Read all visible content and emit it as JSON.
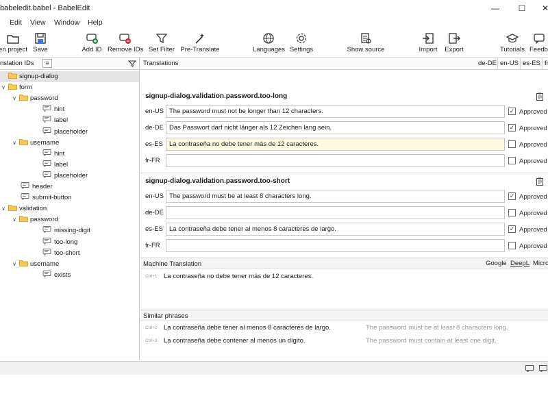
{
  "window": {
    "title": "babeledit.babel - BabelEdit",
    "minimize": "—",
    "maximize": "☐",
    "close": "✕"
  },
  "menu": [
    "Edit",
    "View",
    "Window",
    "Help"
  ],
  "toolbar": [
    {
      "label": "en project",
      "icon": "open-folder-icon"
    },
    {
      "label": "Save",
      "icon": "save-icon"
    },
    {
      "label": "Add ID",
      "icon": "add-id-icon"
    },
    {
      "label": "Remove IDs",
      "icon": "remove-ids-icon"
    },
    {
      "label": "Set Filter",
      "icon": "filter-icon"
    },
    {
      "label": "Pre-Translate",
      "icon": "magic-wand-icon"
    },
    {
      "label": "Languages",
      "icon": "globe-icon"
    },
    {
      "label": "Settings",
      "icon": "gear-icon"
    },
    {
      "label": "Show source",
      "icon": "show-source-icon"
    },
    {
      "label": "Import",
      "icon": "import-icon"
    },
    {
      "label": "Export",
      "icon": "export-icon"
    },
    {
      "label": "Tutorials",
      "icon": "graduation-cap-icon"
    },
    {
      "label": "Feedb",
      "icon": "feedback-icon"
    }
  ],
  "left_panel": {
    "header": "nslation IDs",
    "tree": [
      {
        "label": "signup-dialog",
        "type": "folder",
        "level": 0,
        "chevron": "",
        "selected": true
      },
      {
        "label": "form",
        "type": "folder",
        "level": 0,
        "chevron": "∨"
      },
      {
        "label": "password",
        "type": "folder",
        "level": 1,
        "chevron": "∨"
      },
      {
        "label": "hint",
        "type": "item",
        "level": 2
      },
      {
        "label": "label",
        "type": "item",
        "level": 2
      },
      {
        "label": "placeholder",
        "type": "item",
        "level": 2
      },
      {
        "label": "username",
        "type": "folder",
        "level": 1,
        "chevron": "∨"
      },
      {
        "label": "hint",
        "type": "item",
        "level": 2
      },
      {
        "label": "label",
        "type": "item",
        "level": 2
      },
      {
        "label": "placeholder",
        "type": "item",
        "level": 2
      },
      {
        "label": "header",
        "type": "item",
        "level": 0
      },
      {
        "label": "submit-button",
        "type": "item",
        "level": 0
      },
      {
        "label": "validation",
        "type": "folder",
        "level": 0,
        "chevron": "∨"
      },
      {
        "label": "password",
        "type": "folder",
        "level": 1,
        "chevron": "∨"
      },
      {
        "label": "missing-digit",
        "type": "item",
        "level": 2
      },
      {
        "label": "too-long",
        "type": "item",
        "level": 2
      },
      {
        "label": "too-short",
        "type": "item",
        "level": 2
      },
      {
        "label": "username",
        "type": "folder",
        "level": 1,
        "chevron": "∨"
      },
      {
        "label": "exists",
        "type": "item",
        "level": 2
      }
    ]
  },
  "translations": {
    "header": "Translations",
    "lang_tabs": [
      "de-DE",
      "en-US",
      "es-ES",
      "fr"
    ],
    "approved_label": "Approved",
    "groups": [
      {
        "id": "signup-dialog.validation.password.too-long",
        "rows": [
          {
            "lang": "en-US",
            "text": "The password must not be longer than 12 characters.",
            "approved": true
          },
          {
            "lang": "de-DE",
            "text": "Das Passwort darf nicht länger als 12 Zeichen lang sein.",
            "approved": true
          },
          {
            "lang": "es-ES",
            "text": "La contraseña no debe tener más de 12 caracteres.",
            "approved": false,
            "active": true
          },
          {
            "lang": "fr-FR",
            "text": "",
            "approved": false
          }
        ]
      },
      {
        "id": "signup-dialog.validation.password.too-short",
        "rows": [
          {
            "lang": "en-US",
            "text": "The password must be at least 8 characters long.",
            "approved": true
          },
          {
            "lang": "de-DE",
            "text": "",
            "approved": false
          },
          {
            "lang": "es-ES",
            "text": "La contraseña debe tener al menos 8 caracteres de largo.",
            "approved": true
          },
          {
            "lang": "fr-FR",
            "text": "",
            "approved": false
          }
        ]
      }
    ]
  },
  "machine_translation": {
    "header": "Machine Translation",
    "providers": [
      "Google",
      "DeepL",
      "Micro"
    ],
    "results": [
      {
        "shortcut": "Ctrl+1",
        "text": "La contraseña no debe tener más de 12 caracteres."
      }
    ]
  },
  "similar_phrases": {
    "header": "Similar phrases",
    "items": [
      {
        "shortcut": "Ctrl+2",
        "text": "La contraseña debe tener al menos 8 caracteres de largo.",
        "source": "The password must be at least 8 characters long."
      },
      {
        "shortcut": "Ctrl+3",
        "text": "La contraseña debe contener al menos un dígito.",
        "source": "The password must contain at least one digit."
      }
    ]
  }
}
